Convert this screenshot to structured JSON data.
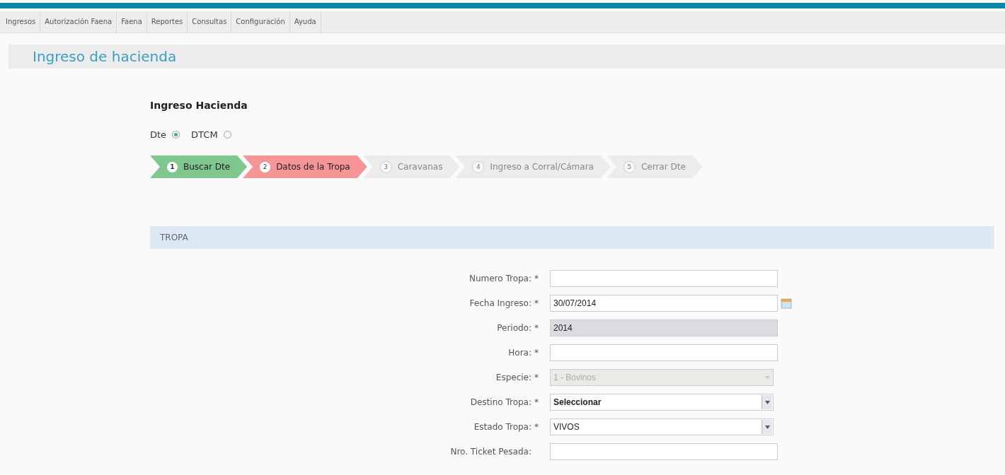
{
  "menu": [
    {
      "label": "Ingresos"
    },
    {
      "label": "Autorización Faena"
    },
    {
      "label": "Faena"
    },
    {
      "label": "Reportes"
    },
    {
      "label": "Consultas"
    },
    {
      "label": "Configuración"
    },
    {
      "label": "Ayuda"
    }
  ],
  "page_title": "Ingreso de hacienda",
  "form_title": "Ingreso Hacienda",
  "document_type": [
    {
      "label": "Dte",
      "selected": true
    },
    {
      "label": "DTCM",
      "selected": false
    }
  ],
  "steps": [
    {
      "number": "1",
      "label": "Buscar Dte",
      "completed": true,
      "selected": false
    },
    {
      "number": "2",
      "label": "Datos de la Tropa",
      "completed": false,
      "selected": true
    },
    {
      "number": "3",
      "label": "Caravanas",
      "completed": false,
      "selected": false
    },
    {
      "number": "4",
      "label": "Ingreso a Corral/Cámara",
      "completed": false,
      "selected": false
    },
    {
      "number": "5",
      "label": "Cerrar Dte",
      "completed": false,
      "selected": false
    }
  ],
  "section": {
    "title": "TROPA"
  },
  "fields": [
    {
      "label": "Numero Tropa:",
      "required": true,
      "kind": "text"
    },
    {
      "label": "Fecha Ingreso:",
      "required": true,
      "kind": "date",
      "value": "30/07/2014"
    },
    {
      "label": "Periodo:",
      "required": true,
      "kind": "readonly",
      "value": "2014"
    },
    {
      "label": "Hora:",
      "required": true,
      "kind": "text"
    },
    {
      "label": "Especie:",
      "required": true,
      "kind": "select",
      "disabled": true,
      "value": "1 - Bovinos"
    },
    {
      "label": "Destino Tropa:",
      "required": true,
      "kind": "select",
      "disabled": false,
      "value": "Seleccionar",
      "bold": true
    },
    {
      "label": "Estado Tropa:",
      "required": true,
      "kind": "select",
      "disabled": false,
      "value": "VIVOS",
      "bold": false
    },
    {
      "label": "Nro. Ticket Pesada:",
      "required": false,
      "kind": "text"
    }
  ],
  "required_mark": "*"
}
